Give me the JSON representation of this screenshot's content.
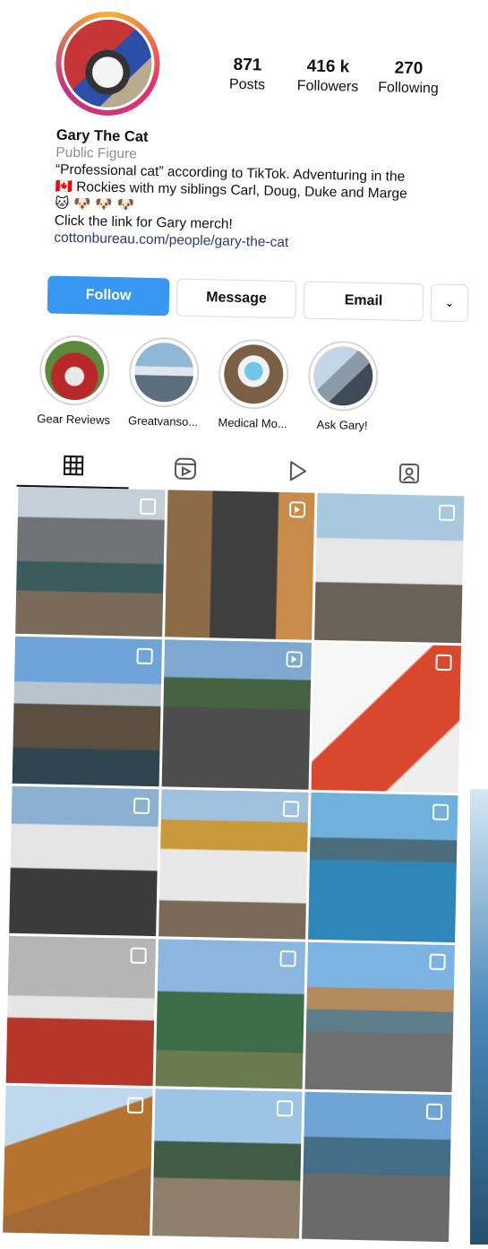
{
  "profile": {
    "posts": "871",
    "posts_label": "Posts",
    "followers": "416 k",
    "followers_label": "Followers",
    "following": "270",
    "following_label": "Following",
    "name": "Gary The Cat",
    "category": "Public Figure",
    "bio_line1": "“Professional cat” according to TikTok. Adventuring in the",
    "bio_flag": "🇨🇦",
    "bio_line2": " Rockies with my siblings Carl, Doug, Duke and Marge",
    "bio_emoji": "🐱 🐶 🐶 🐶",
    "bio_line3": "Click the link for Gary merch!",
    "link": "cottonbureau.com/people/gary-the-cat"
  },
  "buttons": {
    "follow": "Follow",
    "message": "Message",
    "email": "Email",
    "more": "⌄"
  },
  "highlights": [
    {
      "label": "Gear Reviews"
    },
    {
      "label": "Greatvanso..."
    },
    {
      "label": "Medical Mo..."
    },
    {
      "label": "Ask Gary!"
    }
  ],
  "tabs": [
    "grid-icon",
    "reels-icon",
    "video-icon",
    "tagged-icon"
  ],
  "grid": [
    {
      "type": "carousel"
    },
    {
      "type": "reel"
    },
    {
      "type": "carousel"
    },
    {
      "type": "carousel"
    },
    {
      "type": "reel"
    },
    {
      "type": "carousel"
    },
    {
      "type": "carousel"
    },
    {
      "type": "carousel"
    },
    {
      "type": "carousel"
    },
    {
      "type": "carousel"
    },
    {
      "type": "carousel"
    },
    {
      "type": "carousel"
    },
    {
      "type": "carousel"
    },
    {
      "type": "carousel"
    },
    {
      "type": "carousel"
    }
  ]
}
